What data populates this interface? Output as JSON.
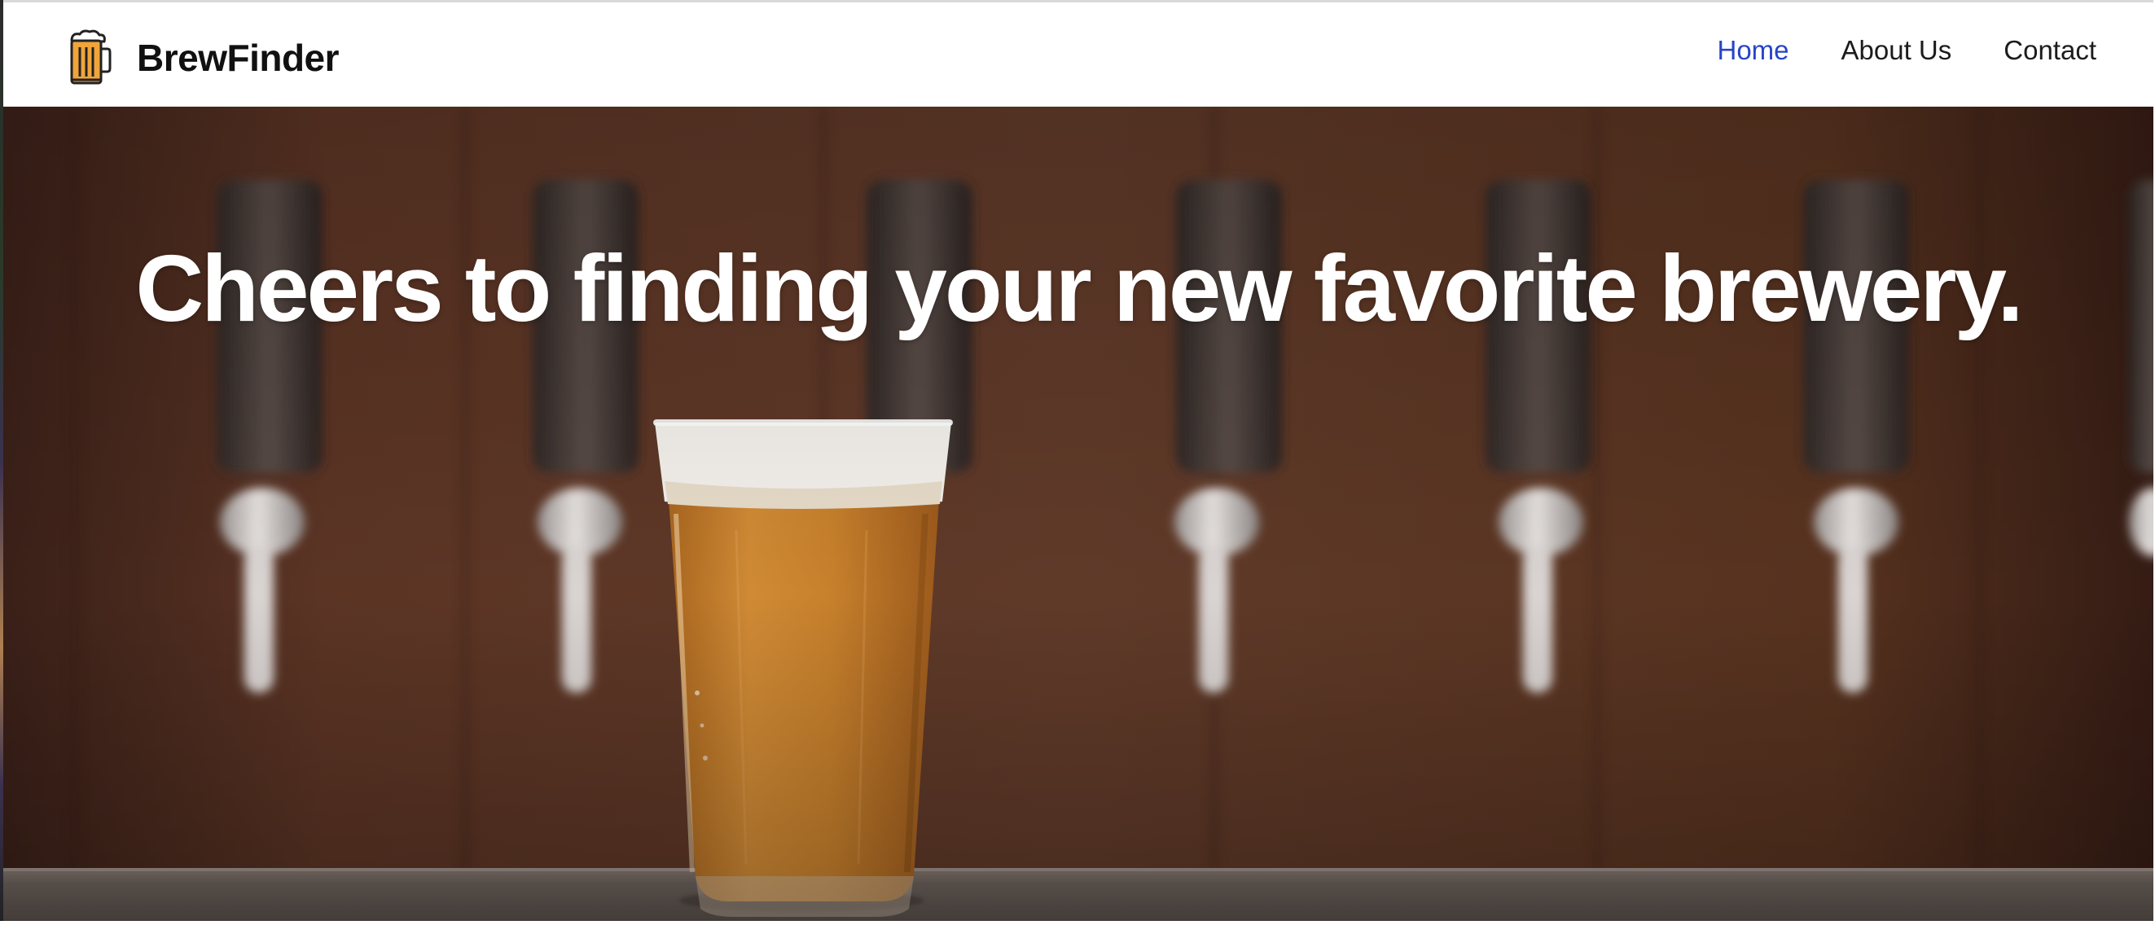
{
  "brand": {
    "name": "BrewFinder",
    "icon": "beer-mug-icon"
  },
  "nav": {
    "items": [
      {
        "label": "Home",
        "active": true
      },
      {
        "label": "About Us",
        "active": false
      },
      {
        "label": "Contact",
        "active": false
      }
    ]
  },
  "hero": {
    "headline": "Cheers to finding your new favorite brewery.",
    "image": "beer-glass-taps-image"
  },
  "colors": {
    "nav_active": "#2744c7",
    "text_dark": "#1c1c1c",
    "hero_text": "#ffffff",
    "beer_amber": "#c8832e",
    "wood_brown": "#5e3828"
  }
}
